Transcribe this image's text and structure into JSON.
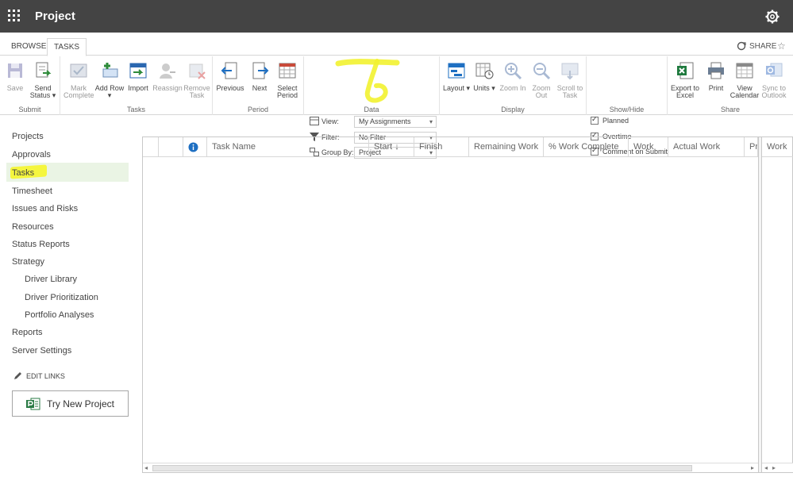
{
  "suitebar": {
    "title": "Project",
    "waffle_icon": "waffle-icon",
    "settings_icon": "gear-icon"
  },
  "tabs": {
    "browse": "BROWSE",
    "tasks": "TASKS",
    "share": "SHARE"
  },
  "ribbon": {
    "submit": {
      "label": "Submit",
      "save": "Save",
      "send_status": "Send Status ▾"
    },
    "tasks": {
      "label": "Tasks",
      "mark_complete": "Mark Complete",
      "add_row": "Add Row ▾",
      "import": "Import",
      "reassign": "Reassign",
      "remove_task": "Remove Task"
    },
    "period": {
      "label": "Period",
      "previous": "Previous",
      "next": "Next",
      "select_period": "Select Period"
    },
    "data": {
      "label": "Data",
      "view_label": "View:",
      "view_value": "My Assignments",
      "filter_label": "Filter:",
      "filter_value": "No Filter",
      "group_label": "Group By:",
      "group_value": "Project"
    },
    "display": {
      "label": "Display",
      "layout": "Layout ▾",
      "units": "Units ▾",
      "zoom_in": "Zoom In",
      "zoom_out": "Zoom Out",
      "scroll_to_task": "Scroll to Task"
    },
    "showhide": {
      "label": "Show/Hide",
      "planned": "Planned",
      "overtime": "Overtime",
      "comment": "Comment on Submit"
    },
    "share": {
      "label": "Share",
      "export": "Export to Excel",
      "print": "Print",
      "view_calendar": "View Calendar",
      "sync": "Sync to Outlook"
    }
  },
  "nav": {
    "items": [
      "Projects",
      "Approvals",
      "Tasks",
      "Timesheet",
      "Issues and Risks",
      "Resources",
      "Status Reports",
      "Strategy"
    ],
    "sub_items": [
      "Driver Library",
      "Driver Prioritization",
      "Portfolio Analyses"
    ],
    "bottom_items": [
      "Reports",
      "Server Settings"
    ],
    "edit_links": "EDIT LINKS",
    "try_new": "Try New Project"
  },
  "grid": {
    "columns": [
      "Task Name",
      "Start ↓",
      "Finish",
      "Remaining Work",
      "% Work Complete",
      "Work",
      "Actual Work",
      "Pr"
    ],
    "right_column": "Work"
  },
  "colors": {
    "suitebar": "#444444",
    "selected_nav": "#eaf4e4",
    "highlighter": "#f5f535",
    "accent_blue": "#1e6fc2"
  }
}
